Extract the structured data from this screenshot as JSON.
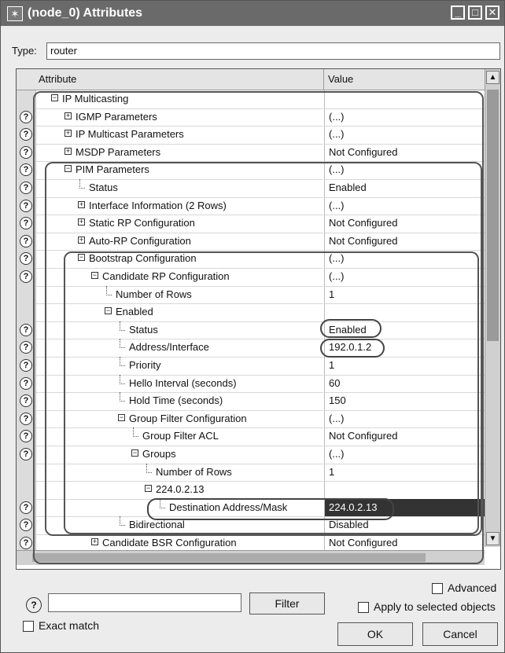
{
  "window": {
    "title": "(node_0) Attributes",
    "title_icon": "pin-icon"
  },
  "type_row": {
    "label": "Type:",
    "value": "router"
  },
  "grid": {
    "col_attribute": "Attribute",
    "col_value": "Value",
    "rows": [
      {
        "label": "IP Multicasting",
        "value": "",
        "help": false,
        "expander": "minus",
        "depth": 0
      },
      {
        "label": "IGMP Parameters",
        "value": "(...)",
        "help": true,
        "expander": "plus",
        "depth": 1
      },
      {
        "label": "IP Multicast Parameters",
        "value": "(...)",
        "help": true,
        "expander": "plus",
        "depth": 1
      },
      {
        "label": "MSDP Parameters",
        "value": "Not Configured",
        "help": true,
        "expander": "plus",
        "depth": 1
      },
      {
        "label": "PIM Parameters",
        "value": "(...)",
        "help": true,
        "expander": "minus",
        "depth": 1
      },
      {
        "label": "Status",
        "value": "Enabled",
        "help": true,
        "expander": "none",
        "depth": 2
      },
      {
        "label": "Interface Information (2 Rows)",
        "value": "(...)",
        "help": true,
        "expander": "plus",
        "depth": 2
      },
      {
        "label": "Static RP Configuration",
        "value": "Not Configured",
        "help": true,
        "expander": "plus",
        "depth": 2
      },
      {
        "label": "Auto-RP Configuration",
        "value": "Not Configured",
        "help": true,
        "expander": "plus",
        "depth": 2
      },
      {
        "label": "Bootstrap Configuration",
        "value": "(...)",
        "help": true,
        "expander": "minus",
        "depth": 2
      },
      {
        "label": "Candidate RP Configuration",
        "value": "(...)",
        "help": true,
        "expander": "minus",
        "depth": 3
      },
      {
        "label": "Number of Rows",
        "value": "1",
        "help": false,
        "expander": "none",
        "depth": 4
      },
      {
        "label": "Enabled",
        "value": "",
        "help": false,
        "expander": "minus",
        "depth": 4
      },
      {
        "label": "Status",
        "value": "Enabled",
        "help": true,
        "expander": "none",
        "depth": 5
      },
      {
        "label": "Address/Interface",
        "value": "192.0.1.2",
        "help": true,
        "expander": "none",
        "depth": 5
      },
      {
        "label": "Priority",
        "value": "1",
        "help": true,
        "expander": "none",
        "depth": 5
      },
      {
        "label": "Hello Interval (seconds)",
        "value": "60",
        "help": true,
        "expander": "none",
        "depth": 5
      },
      {
        "label": "Hold Time (seconds)",
        "value": "150",
        "help": true,
        "expander": "none",
        "depth": 5
      },
      {
        "label": "Group Filter Configuration",
        "value": "(...)",
        "help": true,
        "expander": "minus",
        "depth": 5
      },
      {
        "label": "Group Filter ACL",
        "value": "Not Configured",
        "help": true,
        "expander": "none",
        "depth": 6
      },
      {
        "label": "Groups",
        "value": "(...)",
        "help": true,
        "expander": "minus",
        "depth": 6
      },
      {
        "label": "Number of Rows",
        "value": "1",
        "help": false,
        "expander": "none",
        "depth": 7
      },
      {
        "label": "224.0.2.13",
        "value": "",
        "help": false,
        "expander": "minus",
        "depth": 7
      },
      {
        "label": "Destination Address/Mask",
        "value": "224.0.2.13",
        "help": true,
        "expander": "none",
        "depth": 8,
        "selected": true
      },
      {
        "label": "Bidirectional",
        "value": "Disabled",
        "help": true,
        "expander": "none",
        "depth": 5
      },
      {
        "label": "Candidate BSR Configuration",
        "value": "Not Configured",
        "help": true,
        "expander": "plus",
        "depth": 3
      }
    ]
  },
  "bottom": {
    "advanced_label": "Advanced",
    "filter_button": "Filter",
    "apply_label": "Apply to selected objects",
    "exact_match_label": "Exact match",
    "ok_label": "OK",
    "cancel_label": "Cancel"
  }
}
